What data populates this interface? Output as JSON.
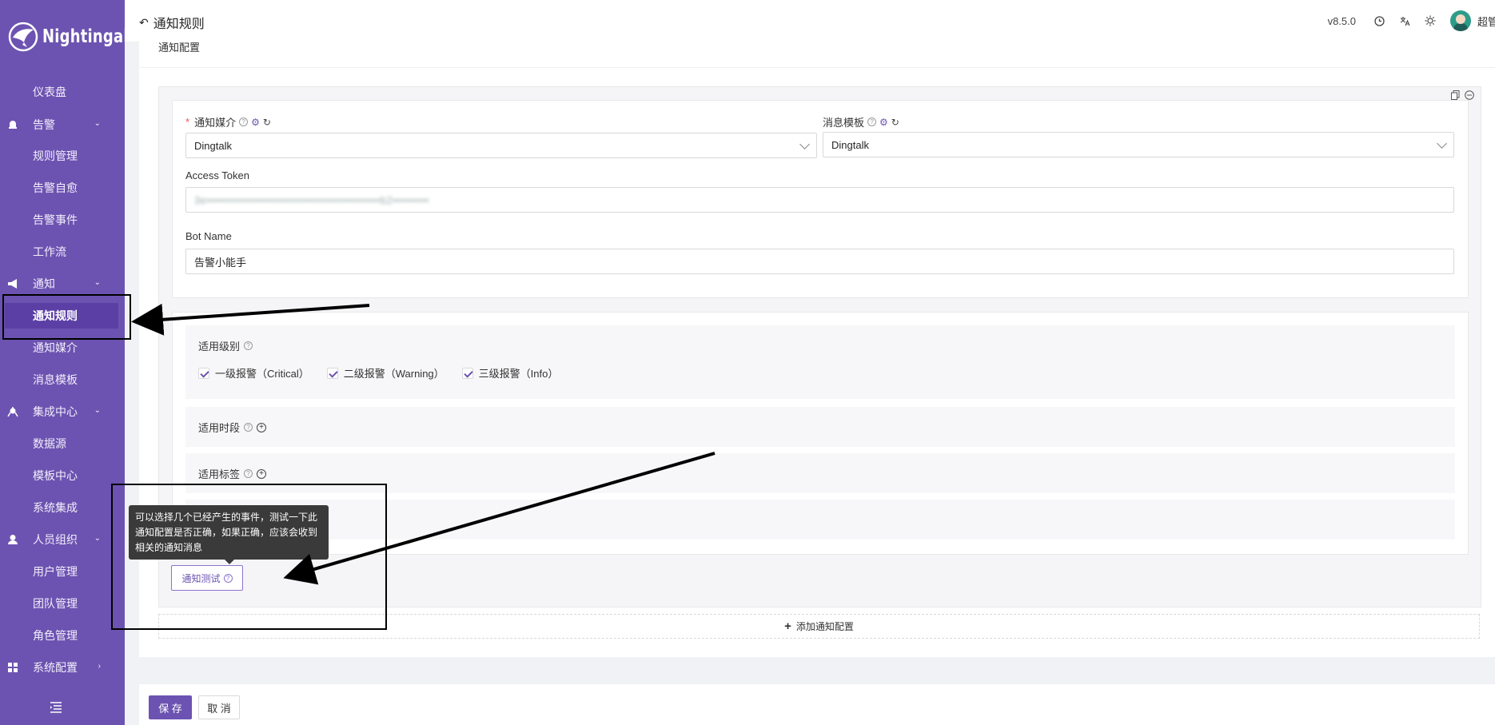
{
  "app": {
    "name": "Nightingale",
    "version": "v8.5.0",
    "user": "超管"
  },
  "header": {
    "title": "通知规则"
  },
  "sidebar": {
    "items": [
      {
        "label": "仪表盘",
        "type": "sub"
      },
      {
        "label": "告警",
        "type": "group"
      },
      {
        "label": "规则管理",
        "type": "sub"
      },
      {
        "label": "告警自愈",
        "type": "sub"
      },
      {
        "label": "告警事件",
        "type": "sub"
      },
      {
        "label": "工作流",
        "type": "sub"
      },
      {
        "label": "通知",
        "type": "group"
      },
      {
        "label": "通知规则",
        "type": "sub",
        "active": true
      },
      {
        "label": "通知媒介",
        "type": "sub"
      },
      {
        "label": "消息模板",
        "type": "sub"
      },
      {
        "label": "集成中心",
        "type": "group"
      },
      {
        "label": "数据源",
        "type": "sub"
      },
      {
        "label": "模板中心",
        "type": "sub"
      },
      {
        "label": "系统集成",
        "type": "sub"
      },
      {
        "label": "人员组织",
        "type": "group"
      },
      {
        "label": "用户管理",
        "type": "sub"
      },
      {
        "label": "团队管理",
        "type": "sub"
      },
      {
        "label": "角色管理",
        "type": "sub"
      },
      {
        "label": "系统配置",
        "type": "group"
      }
    ]
  },
  "section": {
    "title": "通知配置"
  },
  "form": {
    "channel_label": "通知媒介",
    "channel_value": "Dingtalk",
    "template_label": "消息模板",
    "template_value": "Dingtalk",
    "token_label": "Access Token",
    "token_value": "3e•••••••••••••••••••••••••••••••••••••••••••b2•••••••••",
    "botname_label": "Bot Name",
    "botname_value": "告警小能手"
  },
  "filters": {
    "level_label": "适用级别",
    "levels": [
      "一级报警（Critical）",
      "二级报警（Warning）",
      "三级报警（Info）"
    ],
    "time_label": "适用时段",
    "tags_label": "适用标签"
  },
  "test": {
    "button_label": "通知测试",
    "tooltip_lines": [
      "可以选择几个已经产生的事件，测试一下此",
      "通知配置是否正确，如果正确，应该会收到",
      "相关的通知消息"
    ]
  },
  "add_config_label": "添加通知配置",
  "footer": {
    "save_label": "保 存",
    "cancel_label": "取 消"
  },
  "colors": {
    "brand": "#6c53b1",
    "sidebar_active": "#5b3fa5"
  },
  "icons": [
    "bell-icon",
    "megaphone-icon",
    "integration-icon",
    "user-icon",
    "grid-icon",
    "menu-collapse-icon",
    "clock-icon",
    "translate-icon",
    "sun-icon",
    "help-icon",
    "gear-icon",
    "sync-icon",
    "plus-circle-icon",
    "copy-icon",
    "minus-circle-icon"
  ]
}
